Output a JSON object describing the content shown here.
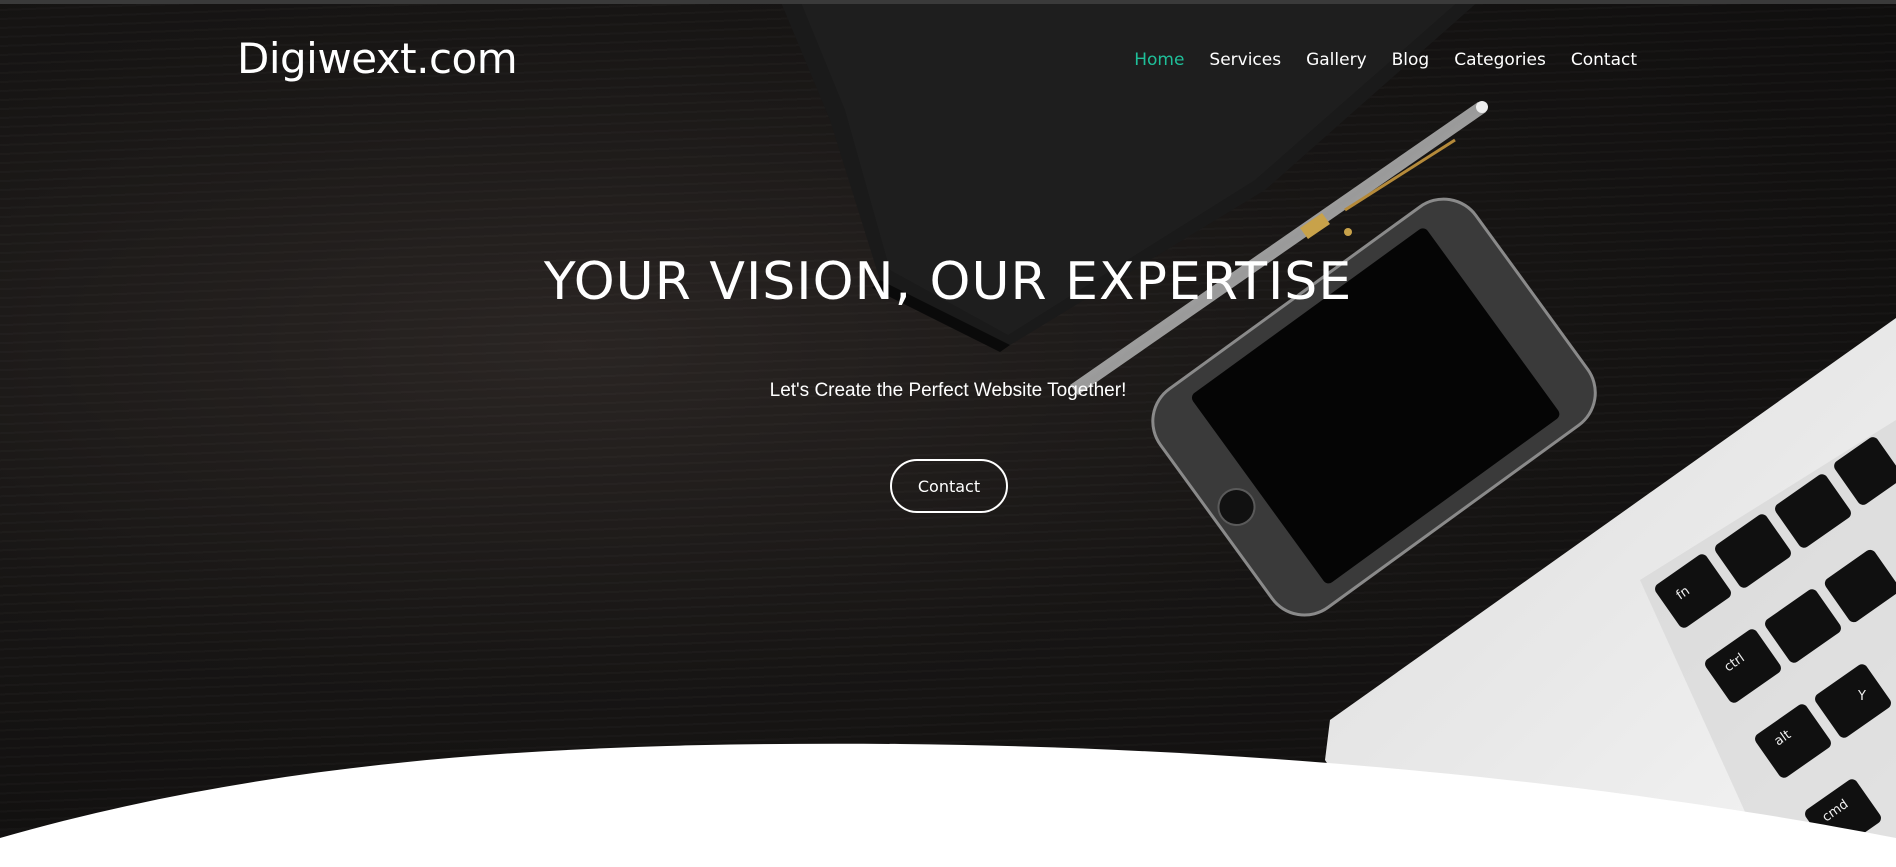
{
  "site": {
    "logo_text": "Digiwext.com"
  },
  "nav": {
    "items": [
      {
        "label": "Home",
        "active": true
      },
      {
        "label": "Services",
        "active": false
      },
      {
        "label": "Gallery",
        "active": false
      },
      {
        "label": "Blog",
        "active": false
      },
      {
        "label": "Categories",
        "active": false
      },
      {
        "label": "Contact",
        "active": false
      }
    ]
  },
  "hero": {
    "headline": "YOUR VISION, OUR EXPERTISE",
    "subheadline": "Let's Create the Perfect Website Together!",
    "cta_label": "Contact"
  },
  "laptop_keys": [
    "fn",
    "ctrl",
    "alt",
    "cmd",
    "Y"
  ],
  "colors": {
    "accent": "#1fbf99",
    "hero_background": "#141212",
    "text": "#ffffff"
  }
}
